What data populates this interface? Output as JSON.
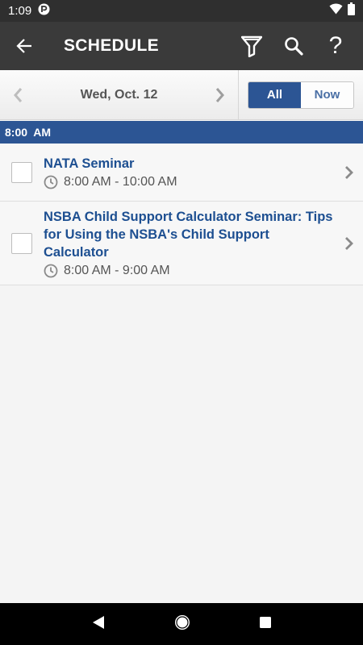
{
  "status_bar": {
    "time": "1:09"
  },
  "app_bar": {
    "title": "SCHEDULE",
    "help_label": "?"
  },
  "date_nav": {
    "date": "Wed, Oct. 12",
    "toggle_all": "All",
    "toggle_now": "Now"
  },
  "time_header": "8:00  AM",
  "sessions": [
    {
      "title": "NATA Seminar",
      "time": "8:00 AM - 10:00 AM"
    },
    {
      "title": "NSBA Child Support Calculator Seminar: Tips for Using the NSBA's Child Support Calculator",
      "time": "8:00 AM - 9:00 AM"
    }
  ],
  "colors": {
    "accent": "#2c5594",
    "title_link": "#1d4f91",
    "app_bar": "#3a3a3a"
  }
}
